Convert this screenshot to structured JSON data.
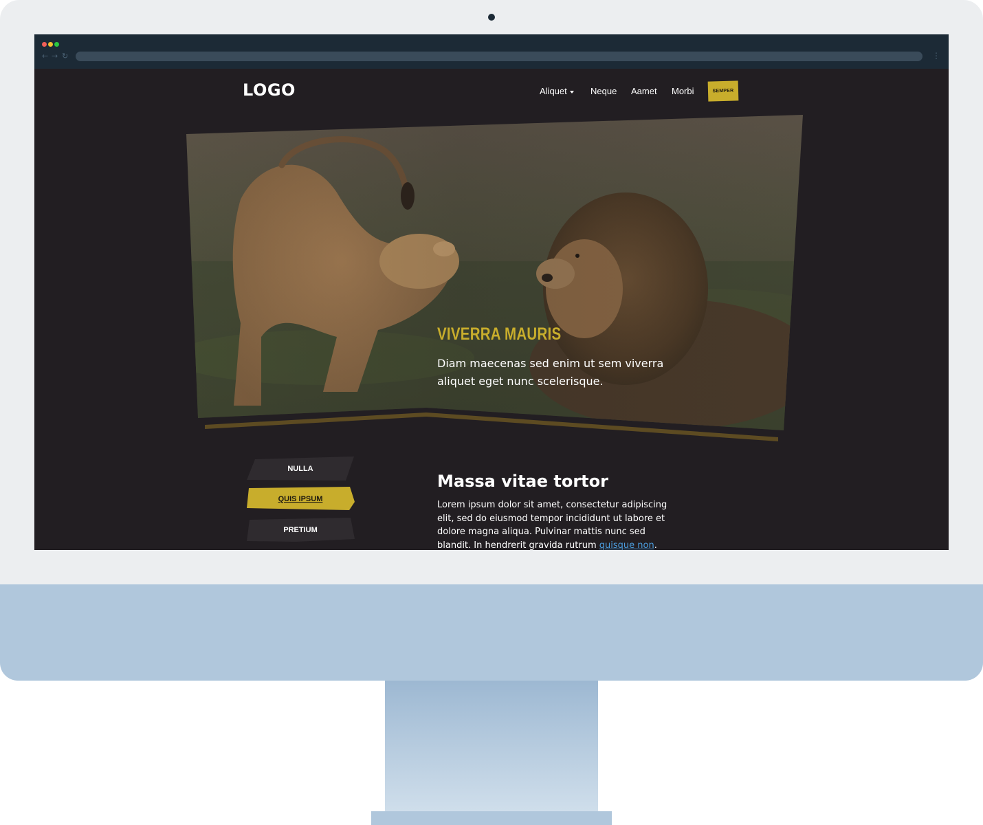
{
  "browser": {
    "dots": [
      "#f25f58",
      "#f5be2f",
      "#2bc840"
    ],
    "nav_icons": [
      "back-arrow-icon",
      "forward-arrow-icon",
      "reload-icon"
    ],
    "back_glyph": "←",
    "forward_glyph": "→",
    "reload_glyph": "↻",
    "menu_glyph": "⋮"
  },
  "site": {
    "logo": "LOGO",
    "nav": [
      {
        "label": "Aliquet",
        "has_dropdown": true
      },
      {
        "label": "Neque"
      },
      {
        "label": "Aamet"
      },
      {
        "label": "Morbi"
      }
    ],
    "cta_label": "SEMPER",
    "accent_color": "#c8ad2c",
    "background_color": "#221e22"
  },
  "hero": {
    "image": "lioness-and-lion-photo",
    "title": "VIVERRA MAURIS",
    "subtitle": "Diam maecenas sed enim ut sem viverra aliquet eget nunc scelerisque."
  },
  "tabs": [
    {
      "label": "NULLA",
      "active": false
    },
    {
      "label": "QUIS IPSUM",
      "active": true
    },
    {
      "label": "PRETIUM",
      "active": false
    }
  ],
  "content": {
    "title": "Massa vitae tortor",
    "body": "Lorem ipsum dolor sit amet, consectetur adipiscing elit, sed do eiusmod tempor incididunt ut labore et dolore magna aliqua. Pulvinar mattis nunc sed blandit. In hendrerit gravida rutrum ",
    "link_text": "quisque non",
    "trailing": "."
  }
}
